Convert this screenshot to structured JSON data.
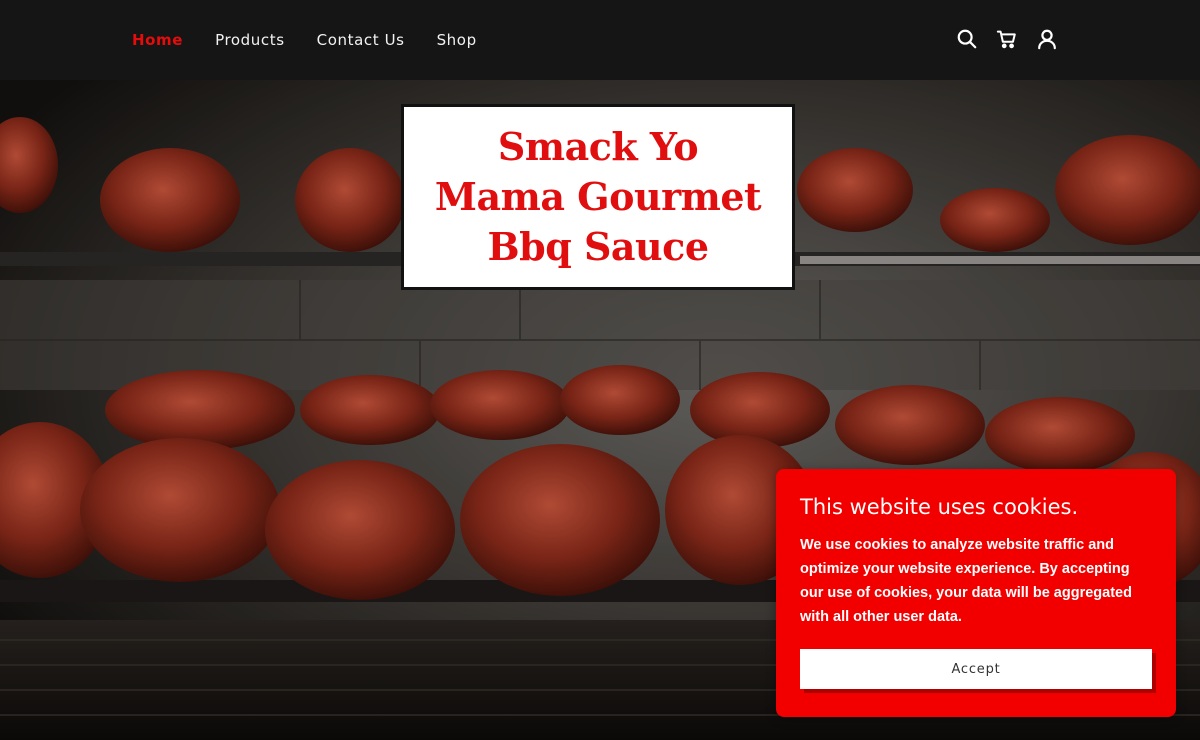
{
  "nav": {
    "items": [
      {
        "label": "Home",
        "active": true
      },
      {
        "label": "Products",
        "active": false
      },
      {
        "label": "Contact Us",
        "active": false
      },
      {
        "label": "Shop",
        "active": false
      }
    ],
    "icons": [
      "search-icon",
      "cart-icon",
      "account-icon"
    ]
  },
  "hero": {
    "title": "Smack Yo Mama Gourmet Bbq Sauce"
  },
  "cookie": {
    "title": "This website uses cookies.",
    "body": "We use cookies to analyze website traffic and optimize your website experience. By accepting our use of cookies, your data will be aggregated with all other user data.",
    "accept_label": "Accept"
  },
  "colors": {
    "accent": "#e50c0c",
    "header_bg": "#151515",
    "cookie_bg": "#f20000"
  }
}
